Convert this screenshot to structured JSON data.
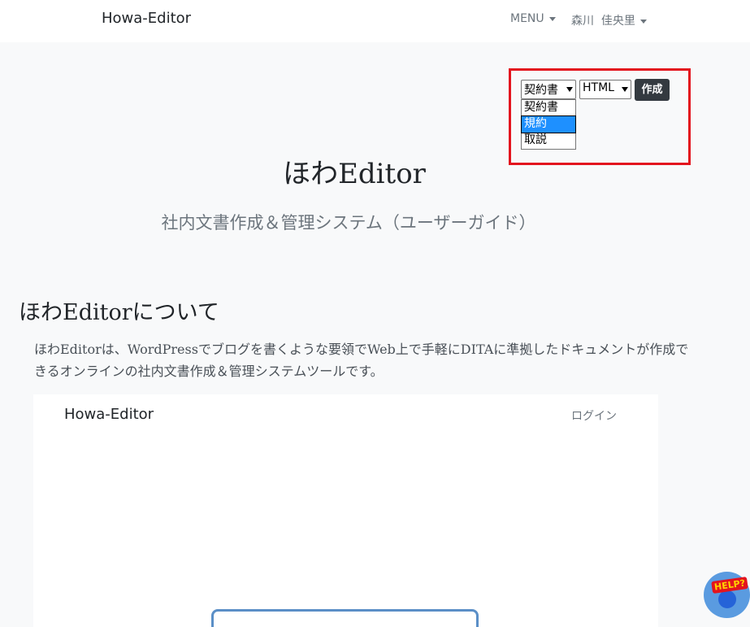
{
  "navbar": {
    "brand": "Howa-Editor",
    "menu_label": "MENU",
    "user_last": "森川",
    "user_first": "佳央里"
  },
  "doc_form": {
    "type_selected": "契約書",
    "type_options": [
      "契約書",
      "規約",
      "取説"
    ],
    "highlighted_option": "規約",
    "format_selected": "HTML",
    "create_label": "作成"
  },
  "hero": {
    "title": "ほわEditor",
    "subtitle": "社内文書作成＆管理システム（ユーザーガイド）"
  },
  "about": {
    "heading": "ほわEditorについて",
    "text": "ほわEditorは、WordPressでブログを書くような要領でWeb上で手軽にDITAに準拠したドキュメントが作成できるオンラインの社内文書作成＆管理システムツールです。"
  },
  "preview": {
    "brand": "Howa-Editor",
    "login_label": "ログイン"
  },
  "help_button": {
    "label": "HELP?"
  },
  "colors": {
    "highlight_border": "#e3141e",
    "create_button": "#343a40",
    "selected_option": "#1e90ff"
  }
}
